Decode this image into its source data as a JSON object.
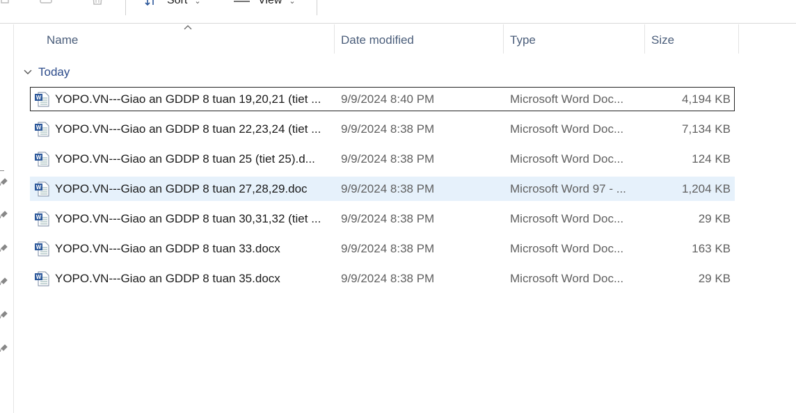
{
  "toolbar": {
    "sort_label": "Sort",
    "view_label": "View",
    "more_label": "···"
  },
  "columns": {
    "name": "Name",
    "date_modified": "Date modified",
    "type": "Type",
    "size": "Size"
  },
  "group": {
    "label": "Today"
  },
  "files": [
    {
      "name": "YOPO.VN---Giao an GDDP 8 tuan 19,20,21 (tiet ...",
      "date": "9/9/2024 8:40 PM",
      "type": "Microsoft Word Doc...",
      "size": "4,194 KB"
    },
    {
      "name": "YOPO.VN---Giao an GDDP 8 tuan 22,23,24 (tiet ...",
      "date": "9/9/2024 8:38 PM",
      "type": "Microsoft Word Doc...",
      "size": "7,134 KB"
    },
    {
      "name": "YOPO.VN---Giao an GDDP 8 tuan 25 (tiet 25).d...",
      "date": "9/9/2024 8:38 PM",
      "type": "Microsoft Word Doc...",
      "size": "124 KB"
    },
    {
      "name": "YOPO.VN---Giao an GDDP 8 tuan 27,28,29.doc",
      "date": "9/9/2024 8:38 PM",
      "type": "Microsoft Word 97 - ...",
      "size": "1,204 KB"
    },
    {
      "name": "YOPO.VN---Giao an GDDP 8 tuan 30,31,32 (tiet ...",
      "date": "9/9/2024 8:38 PM",
      "type": "Microsoft Word Doc...",
      "size": "29 KB"
    },
    {
      "name": "YOPO.VN---Giao an GDDP 8 tuan 33.docx",
      "date": "9/9/2024 8:38 PM",
      "type": "Microsoft Word Doc...",
      "size": "163 KB"
    },
    {
      "name": "YOPO.VN---Giao an GDDP 8 tuan 35.docx",
      "date": "9/9/2024 8:38 PM",
      "type": "Microsoft Word Doc...",
      "size": "29 KB"
    }
  ],
  "colors": {
    "accent": "#2b579a",
    "selected_row": "#e6f1fb",
    "header_text": "#4a5d7a",
    "group_text": "#2b4a8a"
  }
}
